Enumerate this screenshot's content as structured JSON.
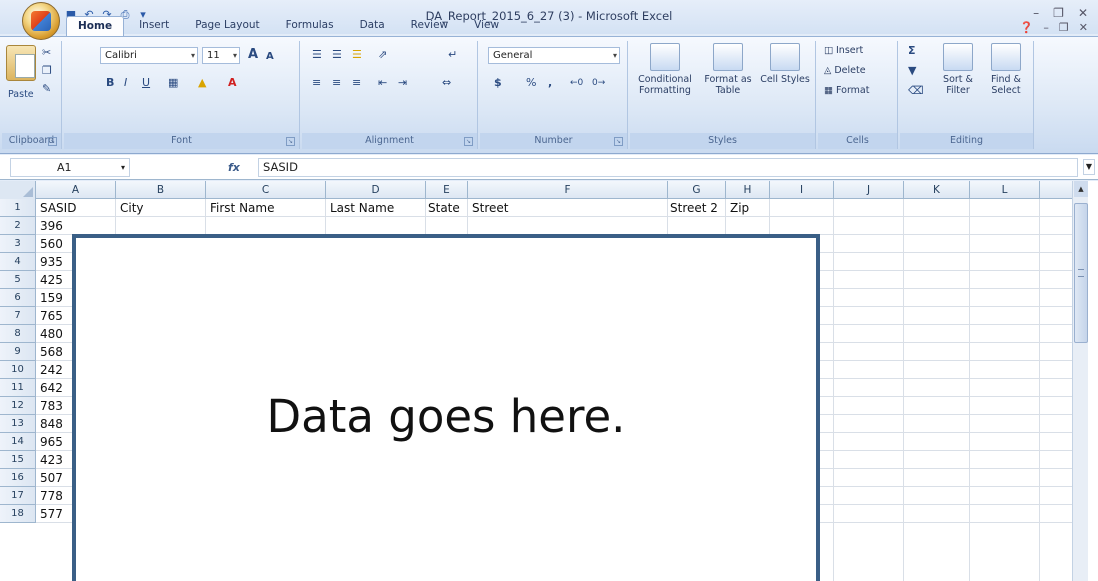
{
  "window": {
    "title": "DA_Report_2015_6_27 (3) - Microsoft Excel"
  },
  "tabs": [
    "Home",
    "Insert",
    "Page Layout",
    "Formulas",
    "Data",
    "Review",
    "View"
  ],
  "ribbon": {
    "clipboard": {
      "label": "Clipboard",
      "paste": "Paste"
    },
    "font": {
      "label": "Font",
      "name": "Calibri",
      "size": "11"
    },
    "alignment": {
      "label": "Alignment"
    },
    "number": {
      "label": "Number",
      "format": "General",
      "currency": "$",
      "percent": "%"
    },
    "styles": {
      "label": "Styles",
      "conditional": "Conditional Formatting",
      "format_table": "Format as Table",
      "cell_styles": "Cell Styles"
    },
    "cells": {
      "label": "Cells",
      "insert": "Insert",
      "delete": "Delete",
      "format": "Format"
    },
    "editing": {
      "label": "Editing",
      "sort": "Sort & Filter",
      "find": "Find & Select"
    }
  },
  "formula_bar": {
    "name_box": "A1",
    "fx": "fx",
    "content": "SASID"
  },
  "sheet": {
    "columns": [
      "A",
      "B",
      "C",
      "D",
      "E",
      "F",
      "G",
      "H",
      "I",
      "J",
      "K",
      "L"
    ],
    "headers": [
      "SASID",
      "City",
      "First Name",
      "Last Name",
      "State",
      "Street",
      "Street 2",
      "Zip"
    ],
    "rows": [
      "1",
      "2",
      "3",
      "4",
      "5",
      "6",
      "7",
      "8",
      "9",
      "10",
      "11",
      "12",
      "13",
      "14",
      "15",
      "16",
      "17",
      "18"
    ],
    "col_a_values": [
      "396",
      "560",
      "935",
      "425",
      "159",
      "765",
      "480",
      "568",
      "242",
      "642",
      "783",
      "848",
      "965",
      "423",
      "507",
      "778",
      "577"
    ]
  },
  "overlay": {
    "text": "Data goes here."
  }
}
